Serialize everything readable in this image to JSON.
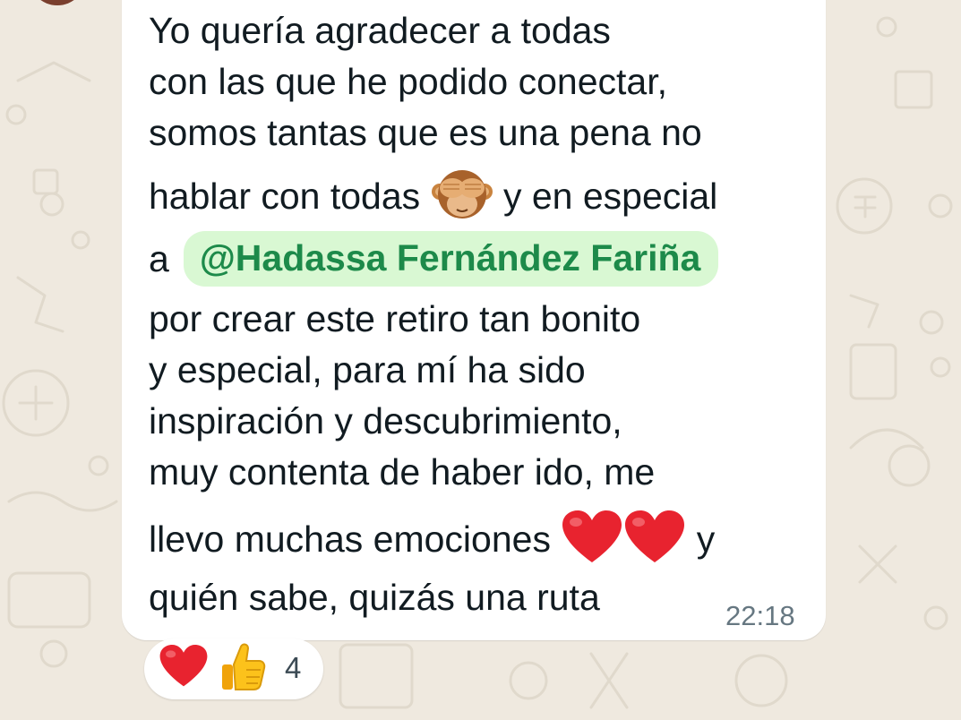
{
  "message": {
    "lines": [
      "Yo quería agradecer a todas",
      "con las que he podido conectar,",
      "somos tantas que es una pena no",
      "hablar con todas",
      "y en especial",
      "a",
      "@Hadassa Fernández Fariña",
      "por crear este retiro tan bonito",
      "y especial, para mí ha sido",
      "inspiración y descubrimiento,",
      "muy contenta de haber ido, me",
      "llevo muchas emociones",
      "y",
      "quién sabe, quizás una ruta"
    ],
    "timestamp": "22:18"
  },
  "reactions": {
    "emojis": [
      "heart-emoji",
      "thumbs-up-emoji"
    ],
    "count": "4"
  },
  "colors": {
    "background": "#efe9df",
    "bubble": "#ffffff",
    "text": "#111b21",
    "mention_bg": "#d9f8d3",
    "mention_text": "#1d8a4a",
    "timestamp": "#667781",
    "heart": "#e8232f"
  }
}
